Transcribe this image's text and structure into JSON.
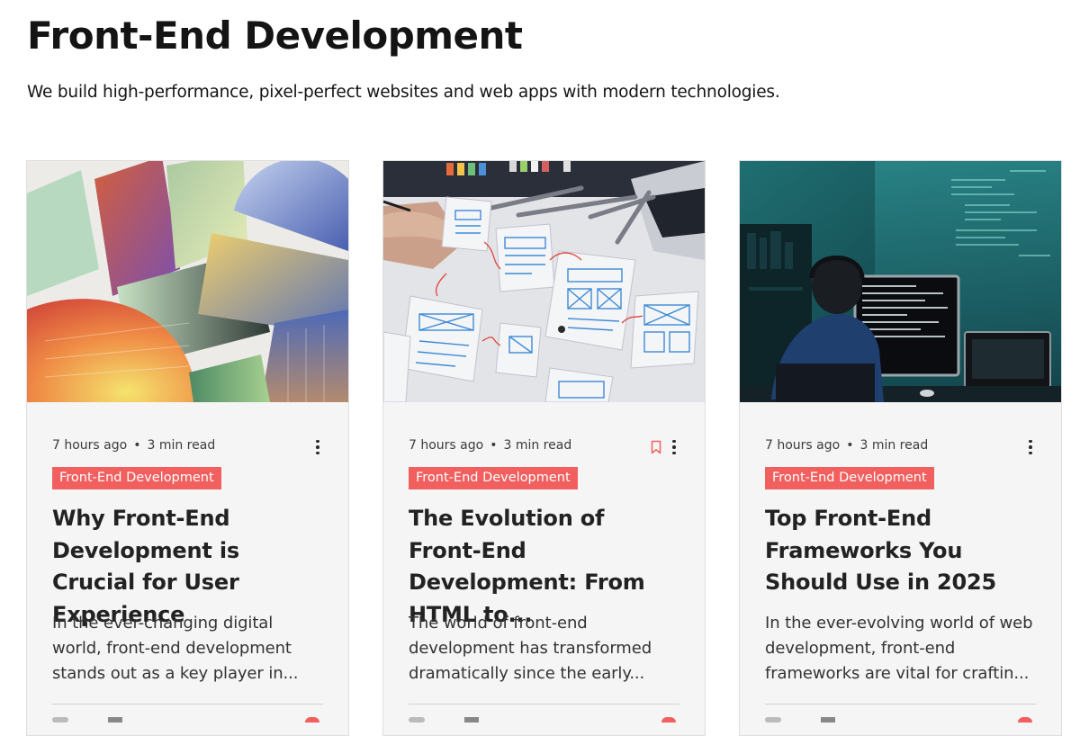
{
  "page": {
    "title": "Front-End Development",
    "subtitle": "We build high-performance, pixel-perfect websites and web apps with modern technologies."
  },
  "colors": {
    "accent": "#f15f5f",
    "card_background": "#f5f5f5",
    "text": "#1f1f1f"
  },
  "cards": [
    {
      "image": "colorful-gradient-panels",
      "time": "7 hours ago",
      "dot": "•",
      "read_time": "3 min read",
      "category": "Front-End Development",
      "title": "Why Front-End Development is Crucial for User Experience",
      "excerpt": "In the ever-changing digital world, front-end development stands out as a key player in...",
      "icons": [
        "more-options-icon"
      ]
    },
    {
      "image": "wireframe-sketches",
      "time": "7 hours ago",
      "dot": "•",
      "read_time": "3 min read",
      "category": "Front-End Development",
      "title": "The Evolution of Front-End Development: From HTML to...",
      "excerpt": "The world of front-end development has transformed dramatically since the early...",
      "icons": [
        "bookmark-icon",
        "more-options-icon"
      ]
    },
    {
      "image": "developer-at-monitors",
      "time": "7 hours ago",
      "dot": "•",
      "read_time": "3 min read",
      "category": "Front-End Development",
      "title": "Top Front-End Frameworks You Should Use in 2025",
      "excerpt": "In the ever-evolving world of web development, front-end frameworks are vital for craftin...",
      "icons": [
        "more-options-icon"
      ]
    }
  ]
}
